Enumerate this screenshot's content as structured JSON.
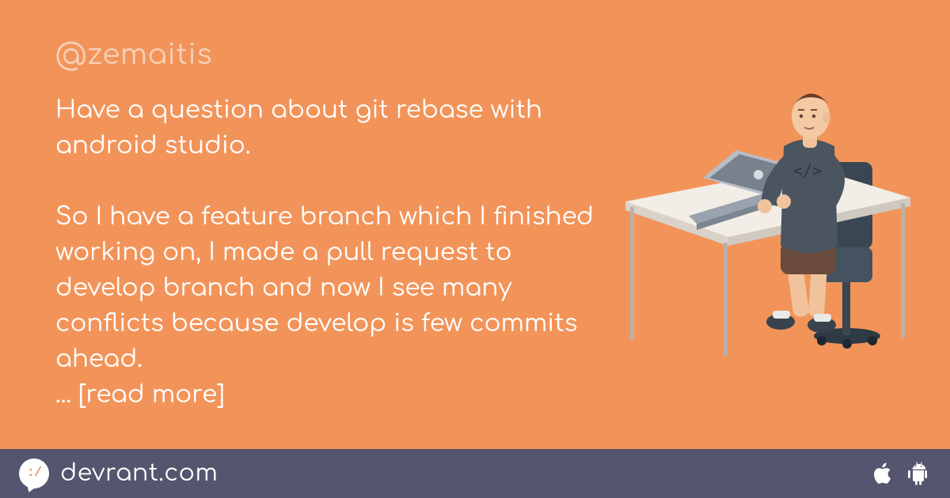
{
  "post": {
    "handle": "@zemaitis",
    "body": "Have a question about git rebase with android studio.\n\nSo I have a feature branch which I finished working on, I made a pull request to develop branch and now I see many conflicts because develop is few commits ahead.\n",
    "read_more": "... [read more]"
  },
  "footer": {
    "brand": "devrant.com",
    "logo_face": ":/"
  },
  "colors": {
    "background": "#f2945a",
    "footer": "#54556e",
    "handle": "#f7cfb5"
  }
}
